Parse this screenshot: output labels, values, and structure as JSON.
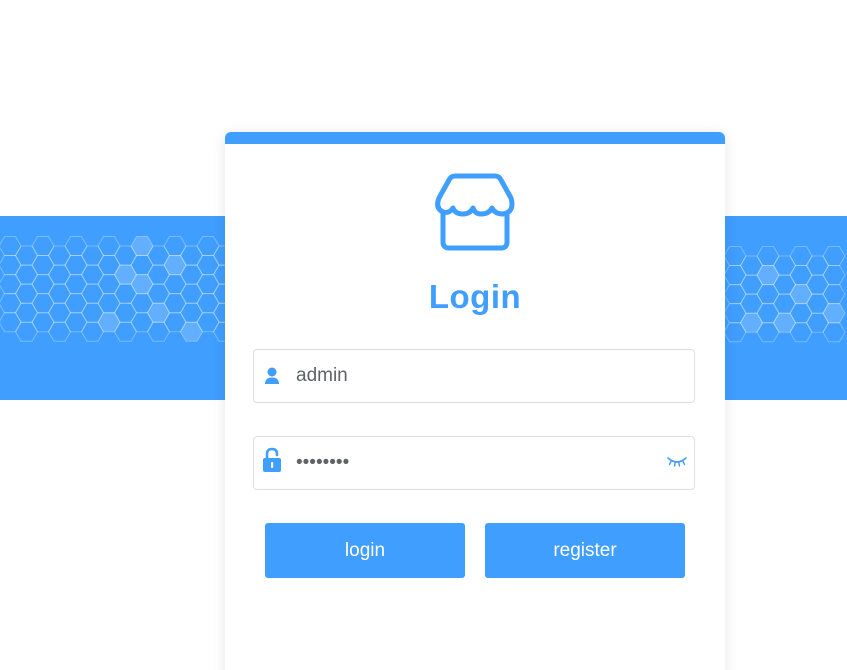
{
  "brand": {
    "accent_color": "#409eff",
    "logo_icon": "store-icon"
  },
  "login_card": {
    "title": "Login",
    "username": {
      "value": "admin",
      "icon": "user-icon"
    },
    "password": {
      "value": "12345678",
      "icon": "lock-icon",
      "toggle_icon": "eye-closed-icon"
    },
    "buttons": {
      "login_label": "login",
      "register_label": "register"
    }
  }
}
